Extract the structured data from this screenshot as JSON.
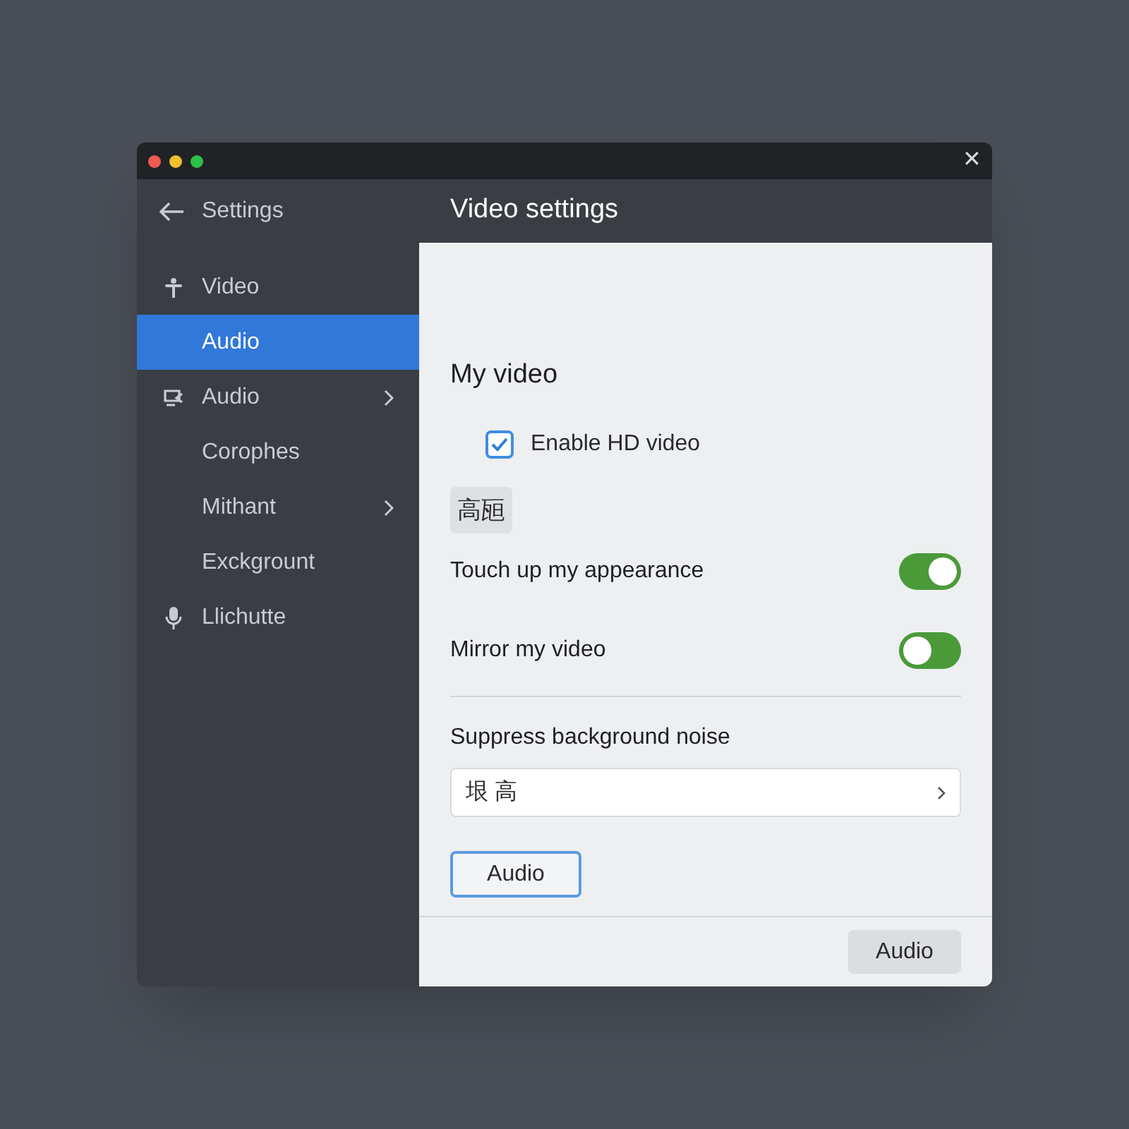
{
  "window": {
    "close": "✕"
  },
  "sidebar": {
    "back": "Settings",
    "items": [
      {
        "label": "Video",
        "kind": "person",
        "selected": false,
        "submenu": false
      },
      {
        "label": "Audio",
        "kind": "plain",
        "selected": true,
        "submenu": false
      },
      {
        "label": "Audio",
        "kind": "screen",
        "selected": false,
        "submenu": true
      },
      {
        "label": "Corophes",
        "kind": "plain",
        "selected": false,
        "submenu": false
      },
      {
        "label": "Mithant",
        "kind": "plain",
        "selected": false,
        "submenu": true
      },
      {
        "label": "Exckgrount",
        "kind": "plain",
        "selected": false,
        "submenu": false
      },
      {
        "label": "Llichutte",
        "kind": "mic",
        "selected": false,
        "submenu": false
      }
    ]
  },
  "header": {
    "title": "Video settings"
  },
  "content": {
    "section": "My video",
    "checkbox": {
      "label": "Enable HD video",
      "checked": true
    },
    "tag": "高瓸",
    "toggles": [
      {
        "label": "Touch up my appearance",
        "on": true
      },
      {
        "label": "Mirror my video",
        "on": false
      }
    ],
    "noise": {
      "label": "Suppress background noise",
      "value": "垠 高"
    },
    "button": "Audio"
  },
  "footer": {
    "button": "Audio"
  }
}
